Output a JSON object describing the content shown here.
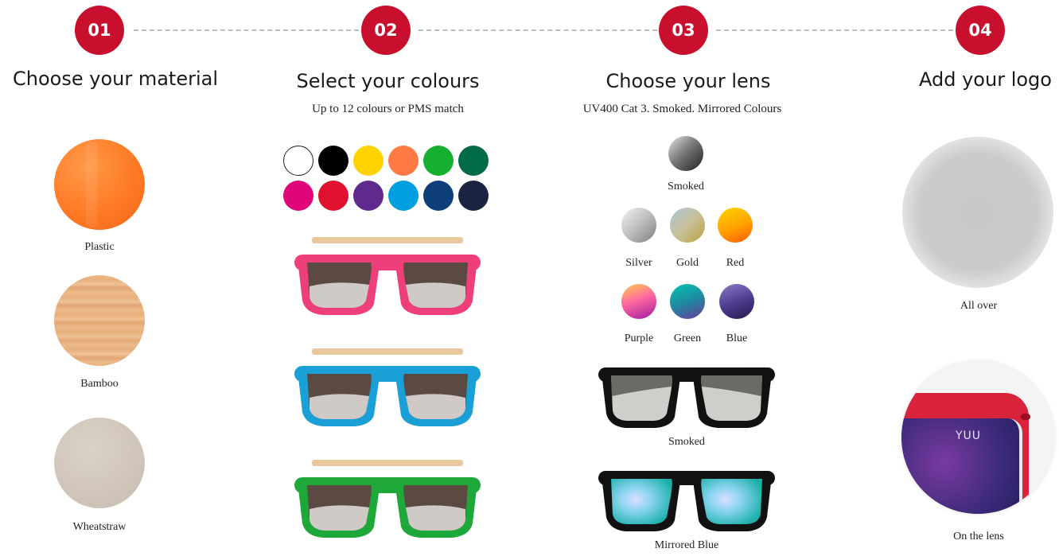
{
  "steps": [
    {
      "number": "01",
      "title": "Choose your material"
    },
    {
      "number": "02",
      "title": "Select your colours",
      "subtitle": "Up to 12 colours or PMS match"
    },
    {
      "number": "03",
      "title": "Choose your lens",
      "subtitle": "UV400 Cat 3. Smoked. Mirrored Colours"
    },
    {
      "number": "04",
      "title": "Add your logo"
    }
  ],
  "materials": [
    {
      "label": "Plastic",
      "icon": "plastic-swatch-icon"
    },
    {
      "label": "Bamboo",
      "icon": "bamboo-swatch-icon"
    },
    {
      "label": "Wheatstraw",
      "icon": "wheatstraw-swatch-icon"
    }
  ],
  "colour_swatches": [
    "#ffffff",
    "#000000",
    "#ffd200",
    "#ff7a45",
    "#16b030",
    "#006b45",
    "#e0067a",
    "#e0102f",
    "#5e2a8e",
    "#00a0e0",
    "#0f3f7a",
    "#1a2340"
  ],
  "colour_examples": [
    {
      "frame": "#ef3f7a",
      "icon": "pink-sunglasses-icon"
    },
    {
      "frame": "#1a9fd6",
      "icon": "blue-sunglasses-icon"
    },
    {
      "frame": "#1fa83a",
      "icon": "green-sunglasses-icon"
    }
  ],
  "lenses": {
    "smoked": "Smoked",
    "row1": [
      "Silver",
      "Gold",
      "Red"
    ],
    "row2": [
      "Purple",
      "Green",
      "Blue"
    ],
    "examples": [
      "Smoked",
      "Mirrored Blue"
    ]
  },
  "logo_options": [
    {
      "label": "All over"
    },
    {
      "label": "On the lens",
      "logo_text": "YUU"
    }
  ],
  "colors": {
    "accent": "#c8102e",
    "dash": "#bdbdbd"
  }
}
